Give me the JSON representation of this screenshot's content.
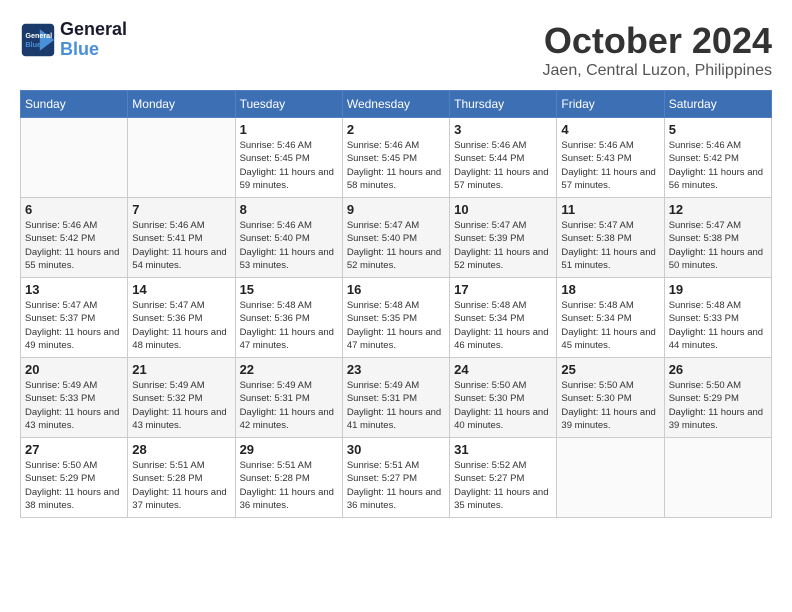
{
  "header": {
    "logo_line1": "General",
    "logo_line2": "Blue",
    "month": "October 2024",
    "location": "Jaen, Central Luzon, Philippines"
  },
  "weekdays": [
    "Sunday",
    "Monday",
    "Tuesday",
    "Wednesday",
    "Thursday",
    "Friday",
    "Saturday"
  ],
  "weeks": [
    [
      {
        "day": "",
        "info": ""
      },
      {
        "day": "",
        "info": ""
      },
      {
        "day": "1",
        "info": "Sunrise: 5:46 AM\nSunset: 5:45 PM\nDaylight: 11 hours and 59 minutes."
      },
      {
        "day": "2",
        "info": "Sunrise: 5:46 AM\nSunset: 5:45 PM\nDaylight: 11 hours and 58 minutes."
      },
      {
        "day": "3",
        "info": "Sunrise: 5:46 AM\nSunset: 5:44 PM\nDaylight: 11 hours and 57 minutes."
      },
      {
        "day": "4",
        "info": "Sunrise: 5:46 AM\nSunset: 5:43 PM\nDaylight: 11 hours and 57 minutes."
      },
      {
        "day": "5",
        "info": "Sunrise: 5:46 AM\nSunset: 5:42 PM\nDaylight: 11 hours and 56 minutes."
      }
    ],
    [
      {
        "day": "6",
        "info": "Sunrise: 5:46 AM\nSunset: 5:42 PM\nDaylight: 11 hours and 55 minutes."
      },
      {
        "day": "7",
        "info": "Sunrise: 5:46 AM\nSunset: 5:41 PM\nDaylight: 11 hours and 54 minutes."
      },
      {
        "day": "8",
        "info": "Sunrise: 5:46 AM\nSunset: 5:40 PM\nDaylight: 11 hours and 53 minutes."
      },
      {
        "day": "9",
        "info": "Sunrise: 5:47 AM\nSunset: 5:40 PM\nDaylight: 11 hours and 52 minutes."
      },
      {
        "day": "10",
        "info": "Sunrise: 5:47 AM\nSunset: 5:39 PM\nDaylight: 11 hours and 52 minutes."
      },
      {
        "day": "11",
        "info": "Sunrise: 5:47 AM\nSunset: 5:38 PM\nDaylight: 11 hours and 51 minutes."
      },
      {
        "day": "12",
        "info": "Sunrise: 5:47 AM\nSunset: 5:38 PM\nDaylight: 11 hours and 50 minutes."
      }
    ],
    [
      {
        "day": "13",
        "info": "Sunrise: 5:47 AM\nSunset: 5:37 PM\nDaylight: 11 hours and 49 minutes."
      },
      {
        "day": "14",
        "info": "Sunrise: 5:47 AM\nSunset: 5:36 PM\nDaylight: 11 hours and 48 minutes."
      },
      {
        "day": "15",
        "info": "Sunrise: 5:48 AM\nSunset: 5:36 PM\nDaylight: 11 hours and 47 minutes."
      },
      {
        "day": "16",
        "info": "Sunrise: 5:48 AM\nSunset: 5:35 PM\nDaylight: 11 hours and 47 minutes."
      },
      {
        "day": "17",
        "info": "Sunrise: 5:48 AM\nSunset: 5:34 PM\nDaylight: 11 hours and 46 minutes."
      },
      {
        "day": "18",
        "info": "Sunrise: 5:48 AM\nSunset: 5:34 PM\nDaylight: 11 hours and 45 minutes."
      },
      {
        "day": "19",
        "info": "Sunrise: 5:48 AM\nSunset: 5:33 PM\nDaylight: 11 hours and 44 minutes."
      }
    ],
    [
      {
        "day": "20",
        "info": "Sunrise: 5:49 AM\nSunset: 5:33 PM\nDaylight: 11 hours and 43 minutes."
      },
      {
        "day": "21",
        "info": "Sunrise: 5:49 AM\nSunset: 5:32 PM\nDaylight: 11 hours and 43 minutes."
      },
      {
        "day": "22",
        "info": "Sunrise: 5:49 AM\nSunset: 5:31 PM\nDaylight: 11 hours and 42 minutes."
      },
      {
        "day": "23",
        "info": "Sunrise: 5:49 AM\nSunset: 5:31 PM\nDaylight: 11 hours and 41 minutes."
      },
      {
        "day": "24",
        "info": "Sunrise: 5:50 AM\nSunset: 5:30 PM\nDaylight: 11 hours and 40 minutes."
      },
      {
        "day": "25",
        "info": "Sunrise: 5:50 AM\nSunset: 5:30 PM\nDaylight: 11 hours and 39 minutes."
      },
      {
        "day": "26",
        "info": "Sunrise: 5:50 AM\nSunset: 5:29 PM\nDaylight: 11 hours and 39 minutes."
      }
    ],
    [
      {
        "day": "27",
        "info": "Sunrise: 5:50 AM\nSunset: 5:29 PM\nDaylight: 11 hours and 38 minutes."
      },
      {
        "day": "28",
        "info": "Sunrise: 5:51 AM\nSunset: 5:28 PM\nDaylight: 11 hours and 37 minutes."
      },
      {
        "day": "29",
        "info": "Sunrise: 5:51 AM\nSunset: 5:28 PM\nDaylight: 11 hours and 36 minutes."
      },
      {
        "day": "30",
        "info": "Sunrise: 5:51 AM\nSunset: 5:27 PM\nDaylight: 11 hours and 36 minutes."
      },
      {
        "day": "31",
        "info": "Sunrise: 5:52 AM\nSunset: 5:27 PM\nDaylight: 11 hours and 35 minutes."
      },
      {
        "day": "",
        "info": ""
      },
      {
        "day": "",
        "info": ""
      }
    ]
  ]
}
